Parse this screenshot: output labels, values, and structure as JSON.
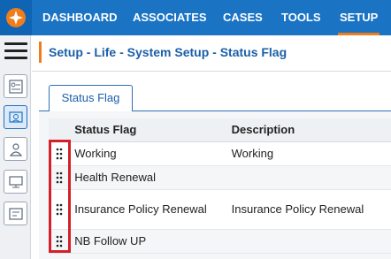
{
  "nav": {
    "items": [
      {
        "label": "DASHBOARD"
      },
      {
        "label": "ASSOCIATES"
      },
      {
        "label": "CASES"
      },
      {
        "label": "TOOLS"
      },
      {
        "label": "SETUP"
      }
    ],
    "active": "SETUP"
  },
  "sidebar": {
    "icons": [
      "hamburger-menu-icon",
      "settings-list-icon",
      "contact-card-icon",
      "user-icon",
      "monitor-icon",
      "form-icon"
    ]
  },
  "breadcrumb": {
    "title": "Setup - Life - System Setup - Status Flag"
  },
  "tab": {
    "label": "Status Flag"
  },
  "table": {
    "columns": [
      "Status Flag",
      "Description"
    ],
    "rows": [
      {
        "flag": "Working",
        "description": "Working"
      },
      {
        "flag": "Health Renewal",
        "description": ""
      },
      {
        "flag": "Insurance Policy Renewal",
        "description": "Insurance Policy Renewal"
      },
      {
        "flag": "NB Follow UP",
        "description": ""
      }
    ]
  },
  "colors": {
    "nav": "#1b73c4",
    "accent": "#f07d1b",
    "title": "#1b5fa8",
    "highlight": "#d4202b"
  }
}
